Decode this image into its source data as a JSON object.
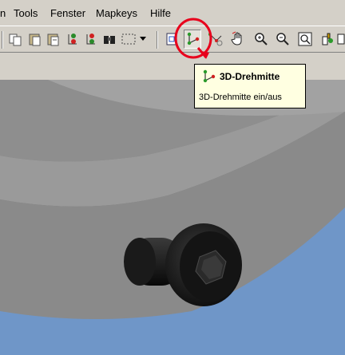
{
  "menu": {
    "items": [
      "n",
      "Tools",
      "Fenster",
      "Mapkeys",
      "Hilfe"
    ]
  },
  "toolbar": {
    "buttons": [
      {
        "name": "copy-icon"
      },
      {
        "name": "paste-icon"
      },
      {
        "name": "paste-special-icon"
      },
      {
        "name": "regenerate-icon"
      },
      {
        "name": "regenerate-manager-icon"
      },
      {
        "name": "find-binoculars-icon"
      },
      {
        "name": "select-box-icon"
      },
      {
        "name": "dropdown-arrow-icon"
      },
      {
        "name": "saved-view-icon"
      },
      {
        "name": "spin-center-icon",
        "pressed": true
      },
      {
        "name": "orientation-mode-icon"
      },
      {
        "name": "pan-hand-icon"
      },
      {
        "name": "zoom-in-icon"
      },
      {
        "name": "zoom-out-icon"
      },
      {
        "name": "refit-icon"
      },
      {
        "name": "repaint-icon"
      }
    ]
  },
  "tooltip": {
    "title": "3D-Drehmitte",
    "description": "3D-Drehmitte ein/aus"
  },
  "colors": {
    "ui_gray": "#d4d0c8",
    "tooltip_bg": "#ffffe1",
    "highlight_red": "#e8001c",
    "model_blue": "#6f96c8",
    "model_gray": "#8a8a8a"
  }
}
